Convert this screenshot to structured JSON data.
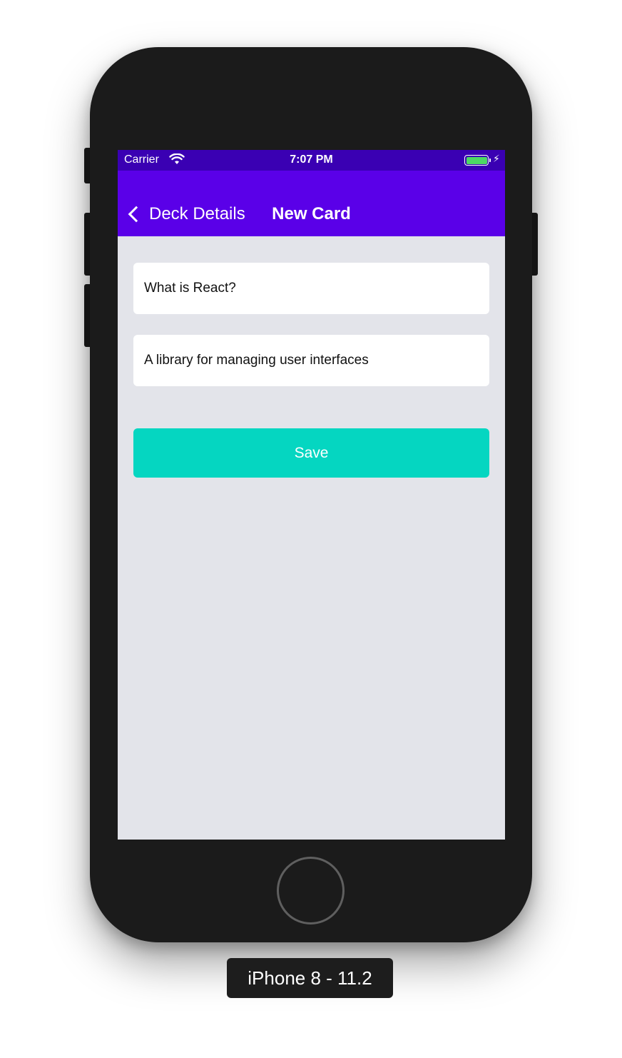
{
  "status_bar": {
    "carrier": "Carrier",
    "time": "7:07 PM",
    "wifi_icon": "wifi-icon",
    "battery_icon": "battery-icon",
    "charging_icon": "bolt-icon",
    "battery_level": 1.0
  },
  "nav": {
    "back_label": "Deck Details",
    "title": "New Card"
  },
  "form": {
    "question_value": "What is React?",
    "answer_value": "A library for managing user interfaces",
    "save_label": "Save"
  },
  "device": {
    "label": "iPhone 8 - 11.2"
  },
  "colors": {
    "status_bar": "#3a00b3",
    "nav_bar": "#5a00e8",
    "background": "#e3e4ea",
    "save_button": "#05d6c1"
  }
}
